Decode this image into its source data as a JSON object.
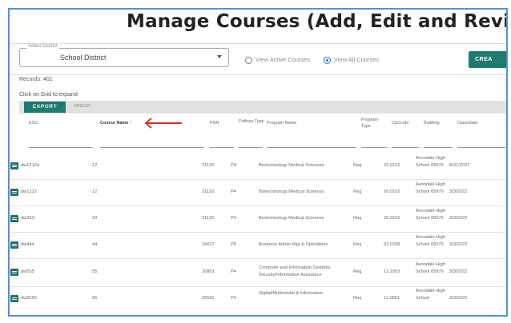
{
  "page": {
    "title": "Manage Courses (Add, Edit and Review r"
  },
  "filters": {
    "district_legend": "Select District",
    "district_value": "School District",
    "view_active_label": "View Active Courses",
    "view_all_label": "View All Courses",
    "selected": "view_all",
    "create_label": "CREA"
  },
  "info": {
    "records": "Records: 401",
    "expand_hint": "Click on Grid to expand"
  },
  "toolbar": {
    "export_label": "EXPORT",
    "search_placeholder": "search"
  },
  "grid": {
    "columns": {
      "esc": "ESC",
      "course_name": "Course Name",
      "sort_indicator": "↑",
      "psn": "PSN",
      "pathway_type": "Pathwa Type",
      "program_name": "Program Name",
      "program_type": "Program Type",
      "cip_code": "CipCode",
      "building": "Building",
      "class_start": "ClassStart"
    },
    "rows": [
      {
        "esc": "dw1212a",
        "course_name": "12",
        "psn": "21120",
        "pathway": "P4",
        "program": "Biotechnology Medical Sciences",
        "program_type": "Reg",
        "cip": "26.0102",
        "building": "Avondale High School 05976",
        "start": "8/31/2021"
      },
      {
        "esc": "dw1212",
        "course_name": "12",
        "psn": "21120",
        "pathway": "P4",
        "program": "Biotechnology Medical Sciences",
        "program_type": "Reg",
        "cip": "26.0102",
        "building": "Avondale High School 05976",
        "start": "3/3/2022"
      },
      {
        "esc": "dw333",
        "course_name": "33",
        "psn": "21120",
        "pathway": "P4",
        "program": "Biotechnology Medical Sciences",
        "program_type": "Reg",
        "cip": "26.0102",
        "building": "Avondale High School 05976",
        "start": "3/3/2022"
      },
      {
        "esc": "dw444",
        "course_name": "44",
        "psn": "16627",
        "pathway": "P5",
        "program": "Business Admin Mgt & Operations",
        "program_type": "Reg",
        "cip": "52.0299",
        "building": "Avondale High School 05976",
        "start": "3/3/2022"
      },
      {
        "esc": "dw555",
        "course_name": "55",
        "psn": "20801",
        "pathway": "P4",
        "program": "Computer and Information Systems Security/Information Assurance",
        "program_type": "Reg",
        "cip": "11.1003",
        "building": "Avondale High School 05976",
        "start": "3/3/2022"
      },
      {
        "esc": "dw5555",
        "course_name": "55",
        "psn": "20562",
        "pathway": "P4",
        "program": "Digital/Multimedia & Information",
        "program_type": "Reg",
        "cip": "11.0801",
        "building": "Avondale High School",
        "start": "3/3/2022"
      }
    ]
  },
  "colors": {
    "accent": "#1f7a70",
    "radio_selected": "#1976d2",
    "annotation_arrow": "#d32f2f",
    "frame_border": "#5a8fd0"
  },
  "icons": {
    "row_action": "edit-icon",
    "dropdown": "caret-down-icon",
    "annotation": "red-arrow-icon"
  }
}
